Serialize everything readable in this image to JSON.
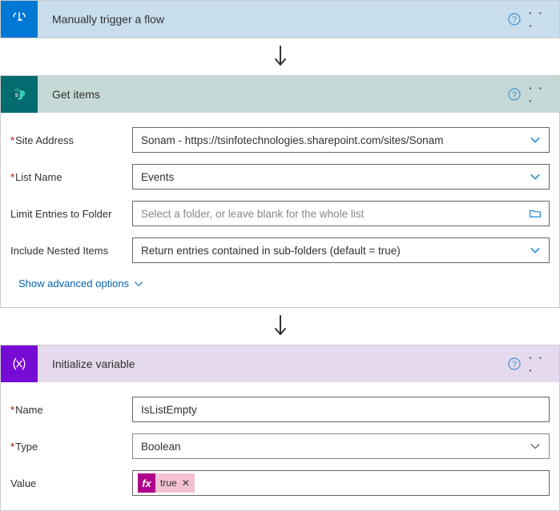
{
  "card1": {
    "title": "Manually trigger a flow",
    "icon": "finger-tap-icon"
  },
  "card2": {
    "title": "Get items",
    "icon": "sharepoint-icon",
    "fields": {
      "siteAddress": {
        "label": "Site Address",
        "value": "Sonam - https://tsinfotechnologies.sharepoint.com/sites/Sonam"
      },
      "listName": {
        "label": "List Name",
        "value": "Events"
      },
      "limitEntries": {
        "label": "Limit Entries to Folder",
        "placeholder": "Select a folder, or leave blank for the whole list"
      },
      "includeNested": {
        "label": "Include Nested Items",
        "value": "Return entries contained in sub-folders (default = true)"
      }
    },
    "advancedLink": "Show advanced options"
  },
  "card3": {
    "title": "Initialize variable",
    "icon": "variable-icon",
    "fields": {
      "name": {
        "label": "Name",
        "value": "IsListEmpty"
      },
      "type": {
        "label": "Type",
        "value": "Boolean"
      },
      "value": {
        "label": "Value",
        "tokenPrefix": "fx",
        "tokenText": "true"
      }
    }
  },
  "common": {
    "dots": "· · ·"
  }
}
